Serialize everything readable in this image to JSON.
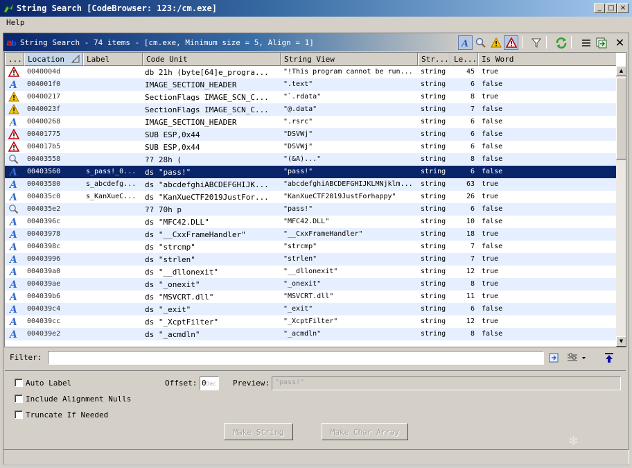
{
  "window": {
    "title": "String Search [CodeBrowser: 123:/cm.exe]"
  },
  "menu": {
    "help": "Help"
  },
  "panel": {
    "title": "String Search - 74 items - [cm.exe, Minimum size = 5, Align = 1]"
  },
  "table": {
    "columns": [
      "...",
      "Location",
      "Label",
      "Code Unit",
      "String View",
      "Str...",
      "Le...",
      "Is Word"
    ],
    "rows": [
      {
        "icon": "warning-red",
        "location": "0040004d",
        "label": "",
        "code": "db 21h (byte[64]e_progra...",
        "view": "\"!This program cannot be run...",
        "type": "string",
        "len": "45",
        "word": "true"
      },
      {
        "icon": "string",
        "location": "004001f0",
        "label": "",
        "code": "IMAGE_SECTION_HEADER",
        "view": "\".text\"",
        "type": "string",
        "len": "6",
        "word": "false"
      },
      {
        "icon": "warning-yellow",
        "location": "00400217",
        "label": "",
        "code": "SectionFlags IMAGE_SCN_C...",
        "view": "\"`.rdata\"",
        "type": "string",
        "len": "8",
        "word": "true"
      },
      {
        "icon": "warning-yellow",
        "location": "0040023f",
        "label": "",
        "code": "SectionFlags IMAGE_SCN_C...",
        "view": "\"@.data\"",
        "type": "string",
        "len": "7",
        "word": "false"
      },
      {
        "icon": "string",
        "location": "00400268",
        "label": "",
        "code": "IMAGE_SECTION_HEADER",
        "view": "\".rsrc\"",
        "type": "string",
        "len": "6",
        "word": "false"
      },
      {
        "icon": "warning-red",
        "location": "00401775",
        "label": "",
        "code": "SUB ESP,0x44",
        "view": "\"DSVWj\"",
        "type": "string",
        "len": "6",
        "word": "false"
      },
      {
        "icon": "warning-red",
        "location": "004017b5",
        "label": "",
        "code": "SUB ESP,0x44",
        "view": "\"DSVWj\"",
        "type": "string",
        "len": "6",
        "word": "false"
      },
      {
        "icon": "search",
        "location": "00403558",
        "label": "",
        "code": "?? 28h    (",
        "view": "\"(&A)...\"",
        "type": "string",
        "len": "8",
        "word": "false"
      },
      {
        "icon": "string",
        "location": "00403560",
        "label": "s_pass!_0...",
        "code": "ds \"pass!\"",
        "view": "\"pass!\"",
        "type": "string",
        "len": "6",
        "word": "false"
      },
      {
        "icon": "string",
        "location": "00403580",
        "label": "s_abcdefg...",
        "code": "ds \"abcdefghiABCDEFGHIJK...",
        "view": "\"abcdefghiABCDEFGHIJKLMNjklm...",
        "type": "string",
        "len": "63",
        "word": "true"
      },
      {
        "icon": "string",
        "location": "004035c0",
        "label": "s_KanXueC...",
        "code": "ds \"KanXueCTF2019JustFor...",
        "view": "\"KanXueCTF2019JustForhappy\"",
        "type": "string",
        "len": "26",
        "word": "true"
      },
      {
        "icon": "search",
        "location": "004035e2",
        "label": "",
        "code": "?? 70h    p",
        "view": "\"pass!\"",
        "type": "string",
        "len": "6",
        "word": "false"
      },
      {
        "icon": "string",
        "location": "0040396c",
        "label": "",
        "code": "ds \"MFC42.DLL\"",
        "view": "\"MFC42.DLL\"",
        "type": "string",
        "len": "10",
        "word": "false"
      },
      {
        "icon": "string",
        "location": "00403978",
        "label": "",
        "code": "ds \"__CxxFrameHandler\"",
        "view": "\"__CxxFrameHandler\"",
        "type": "string",
        "len": "18",
        "word": "true"
      },
      {
        "icon": "string",
        "location": "0040398c",
        "label": "",
        "code": "ds \"strcmp\"",
        "view": "\"strcmp\"",
        "type": "string",
        "len": "7",
        "word": "false"
      },
      {
        "icon": "string",
        "location": "00403996",
        "label": "",
        "code": "ds \"strlen\"",
        "view": "\"strlen\"",
        "type": "string",
        "len": "7",
        "word": "true"
      },
      {
        "icon": "string",
        "location": "004039a0",
        "label": "",
        "code": "ds \"__dllonexit\"",
        "view": "\"__dllonexit\"",
        "type": "string",
        "len": "12",
        "word": "true"
      },
      {
        "icon": "string",
        "location": "004039ae",
        "label": "",
        "code": "ds \"_onexit\"",
        "view": "\"_onexit\"",
        "type": "string",
        "len": "8",
        "word": "true"
      },
      {
        "icon": "string",
        "location": "004039b6",
        "label": "",
        "code": "ds \"MSVCRT.dll\"",
        "view": "\"MSVCRT.dll\"",
        "type": "string",
        "len": "11",
        "word": "true"
      },
      {
        "icon": "string",
        "location": "004039c4",
        "label": "",
        "code": "ds \"_exit\"",
        "view": "\"_exit\"",
        "type": "string",
        "len": "6",
        "word": "false"
      },
      {
        "icon": "string",
        "location": "004039cc",
        "label": "",
        "code": "ds \"_XcptFilter\"",
        "view": "\"_XcptFilter\"",
        "type": "string",
        "len": "12",
        "word": "true"
      },
      {
        "icon": "string",
        "location": "004039e2",
        "label": "",
        "code": "ds \"_acmdln\"",
        "view": "\"_acmdln\"",
        "type": "string",
        "len": "8",
        "word": "false"
      }
    ],
    "selected_index": 8
  },
  "filter": {
    "label": "Filter:",
    "value": ""
  },
  "options": {
    "auto_label": "Auto Label",
    "include_alignment_nulls": "Include Alignment Nulls",
    "truncate_if_needed": "Truncate If Needed",
    "offset_label": "Offset:",
    "offset_value": "0",
    "offset_suffix": "Dec",
    "preview_label": "Preview:",
    "preview_value": "\"pass!\"",
    "make_string": "Make String",
    "make_char_array": "Make Char Array"
  },
  "colors": {
    "selection": "#0a246a",
    "row_alt": "#e6efff",
    "title_gradient_start": "#0a246a"
  }
}
